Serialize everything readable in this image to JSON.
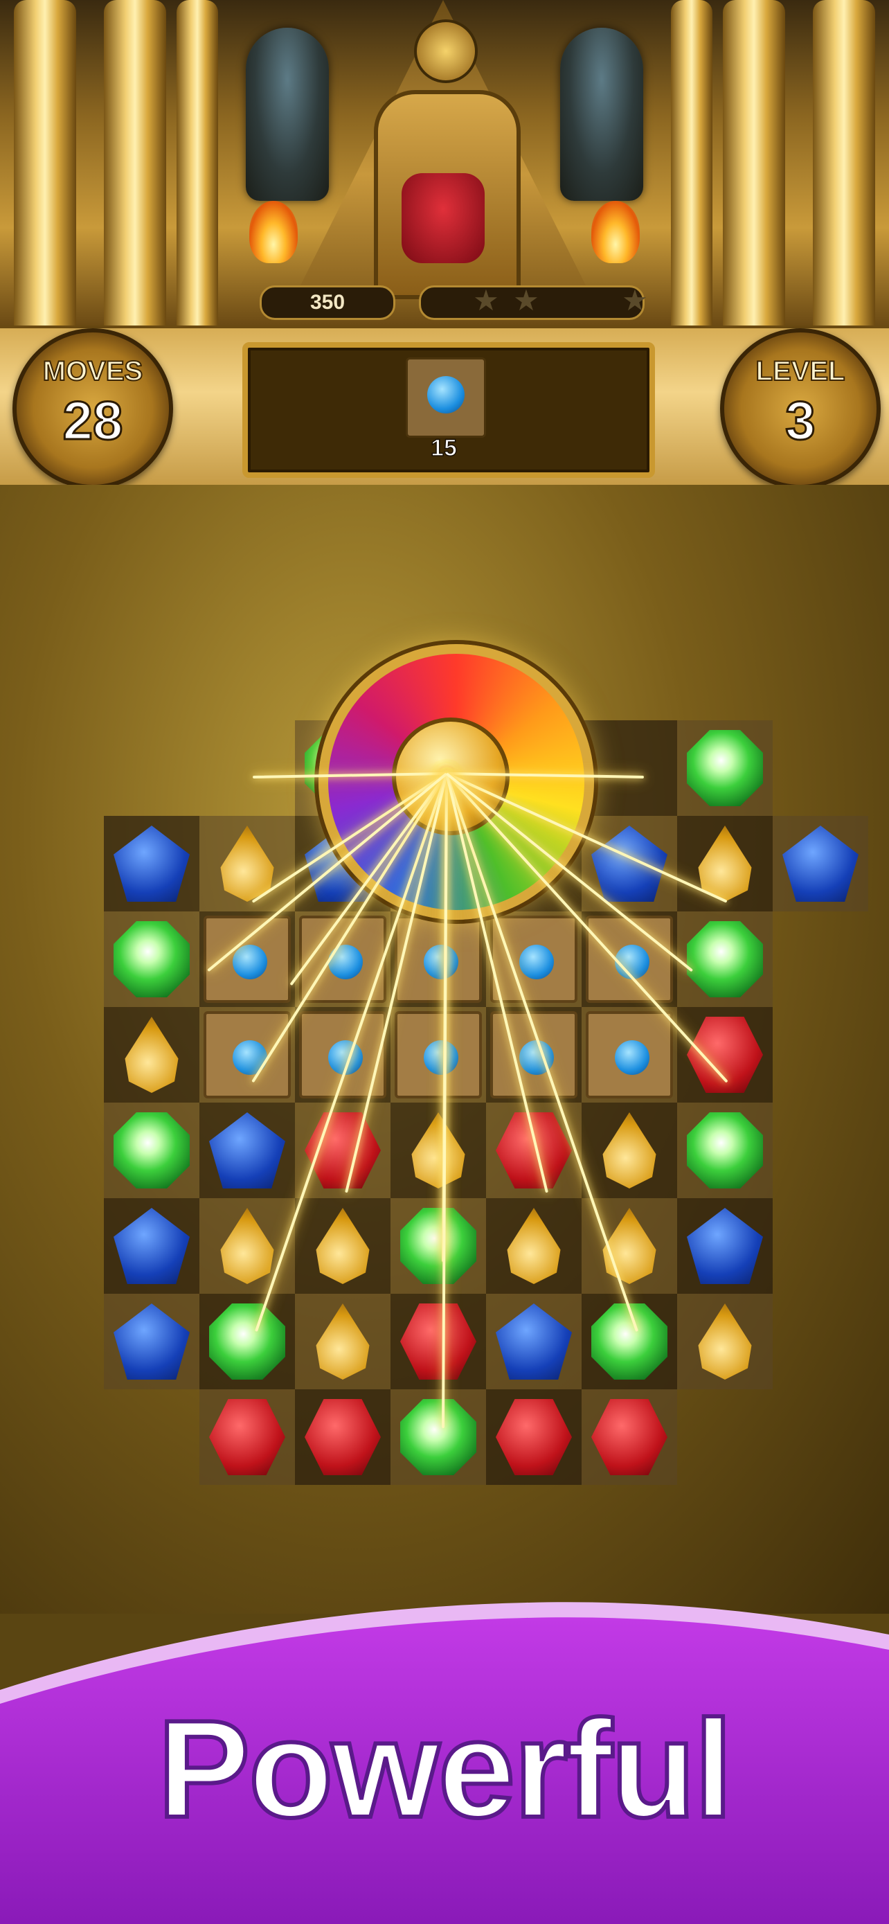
{
  "hud": {
    "score": "350",
    "score_progress": 0.0,
    "stars_earned": 0,
    "stars_total": 3,
    "moves_label": "MOVES",
    "moves_value": "28",
    "level_label": "LEVEL",
    "level_value": "3",
    "goal": {
      "item": "crate-blue-gem",
      "count": "15"
    }
  },
  "board": {
    "rows": [
      [
        "none",
        "none",
        "green",
        "sun",
        "sun",
        "sun",
        "green",
        "none"
      ],
      [
        "blue",
        "yellow",
        "blue",
        "sun",
        "sun",
        "blue",
        "yellow",
        "blue"
      ],
      [
        "green",
        "crate",
        "crate",
        "crate",
        "crate",
        "crate",
        "green",
        "none"
      ],
      [
        "yellow",
        "crate",
        "crate",
        "crate",
        "crate",
        "crate",
        "red",
        "none"
      ],
      [
        "green",
        "blue",
        "red",
        "yellow",
        "red",
        "yellow",
        "green",
        "none"
      ],
      [
        "blue",
        "yellow",
        "yellow",
        "green",
        "yellow",
        "yellow",
        "blue",
        "none"
      ],
      [
        "blue",
        "green",
        "yellow",
        "red",
        "blue",
        "green",
        "yellow",
        "none"
      ],
      [
        "none",
        "red",
        "red",
        "green",
        "red",
        "red",
        "none",
        "none"
      ]
    ],
    "special": "sun-disc-bomb"
  },
  "banner": {
    "text": "Powerful",
    "color": "#b02ad8"
  },
  "colors": {
    "gold": "#d8a83a",
    "banner_purple": "#b02ad8",
    "banner_edge": "#e9b8f4"
  }
}
